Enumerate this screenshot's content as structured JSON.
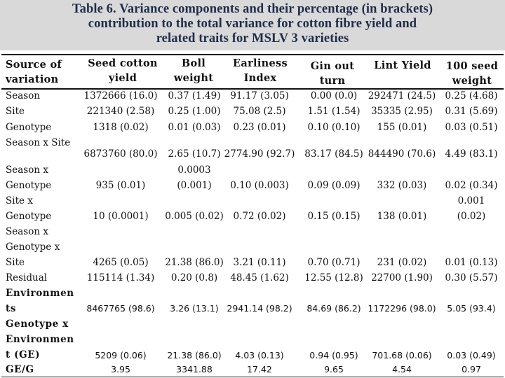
{
  "title": {
    "lines": [
      "Table 6. Variance components and their percentage (in brackets)",
      "contribution to the total variance for cotton fibre yield and",
      "related traits for MSLV 3 varieties"
    ]
  },
  "table": {
    "headers": {
      "source": [
        "Source of",
        "variation"
      ],
      "seed_cotton_yield": [
        "Seed cotton",
        "yield"
      ],
      "boll_weight": [
        "Boll",
        "weight"
      ],
      "earliness_index": [
        "Earliness",
        "Index"
      ],
      "gin_out_turn": [
        "Gin out",
        "turn"
      ],
      "lint_yield": [
        "Lint Yield"
      ],
      "seed_weight_100": [
        "100 seed",
        "weight"
      ]
    },
    "row_labels": {
      "season": "Season",
      "site": "Site",
      "genotype": "Genotype",
      "season_x_site": "Season x Site",
      "season_x_genotype": [
        "Season x",
        "Genotype"
      ],
      "site_x_genotype": [
        "Site x",
        "Genotype"
      ],
      "season_x_genotype_x_site": [
        "Season x",
        "Genotype x",
        "Site"
      ],
      "residual": "Residual",
      "environments": [
        "Environmen",
        "ts"
      ],
      "ge": [
        "Genotype x",
        "Environmen",
        "t (GE)"
      ],
      "ge_g": "GE/G"
    },
    "rows": {
      "season": [
        "1372666 (16.0)",
        "0.37 (1.49)",
        "91.17 (3.05)",
        "0.00 (0.0)",
        "292471 (24.5)",
        "0.25 (4.68)"
      ],
      "site": [
        "221340 (2.58)",
        "0.25 (1.00)",
        "75.08 (2.5)",
        "1.51 (1.54)",
        "35335 (2.95)",
        "0.31 (5.69)"
      ],
      "genotype": [
        "1318 (0.02)",
        "0.01 (0.03)",
        "0.23 (0.01)",
        "0.10 (0.10)",
        "155 (0.01)",
        "0.03 (0.51)"
      ],
      "season_x_site": [
        "6873760 (80.0)",
        "2.65 (10.7)",
        "2774.90 (92.7)",
        "83.17 (84.5)",
        "844490 (70.6)",
        "4.49 (83.1)"
      ],
      "season_x_genotype": [
        "935 (0.01)",
        [
          "0.0003",
          "(0.001)"
        ],
        "0.10 (0.003)",
        "0.09 (0.09)",
        "332 (0.03)",
        "0.02 (0.34)"
      ],
      "site_x_genotype": [
        "10 (0.0001)",
        "0.005 (0.02)",
        "0.72 (0.02)",
        "0.15 (0.15)",
        "138 (0.01)",
        [
          "0.001",
          "(0.02)"
        ]
      ],
      "season_x_genotype_x_site": [
        "4265 (0.05)",
        "21.38 (86.0)",
        "3.21 (0.11)",
        "0.70 (0.71)",
        "231 (0.02)",
        "0.01 (0.13)"
      ],
      "residual": [
        "115114 (1.34)",
        "0.20 (0.8)",
        "48.45 (1.62)",
        "12.55 (12.8)",
        "22700 (1.90)",
        "0.30 (5.57)"
      ],
      "environments": [
        "8467765 (98.6)",
        "3.26 (13.1)",
        "2941.14 (98.2)",
        "84.69 (86.2)",
        "1172296 (98.0)",
        "5.05 (93.4)"
      ],
      "ge": [
        "5209 (0.06)",
        "21.38  (86.0)",
        "4.03 (0.13)",
        "0.94 (0.95)",
        "701.68 (0.06)",
        "0.03 (0.49)"
      ],
      "ge_g": [
        "3.95",
        "3341.88",
        "17.42",
        "9.65",
        "4.54",
        "0.97"
      ]
    }
  }
}
